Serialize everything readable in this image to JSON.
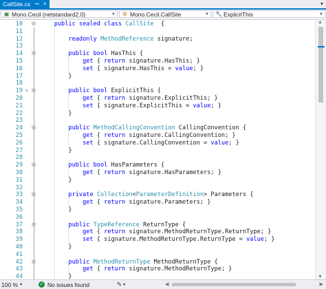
{
  "tab": {
    "title": "CallSite.cs",
    "pin_icon": "pin-icon",
    "close": "×",
    "overflow": "▾"
  },
  "nav": {
    "project": "Mono.Cecil (netstandard2.0)",
    "class": "Mono.Cecil.CallSite",
    "member": "ExplicitThis"
  },
  "editor": {
    "lines": [
      {
        "n": "10",
        "fold": "⊟",
        "code": [
          [
            "    ",
            ""
          ],
          [
            "public sealed class ",
            "kw"
          ],
          [
            "CallSite",
            "ty"
          ],
          [
            "  {",
            ""
          ]
        ]
      },
      {
        "n": "11",
        "fold": "",
        "code": []
      },
      {
        "n": "12",
        "fold": "",
        "code": [
          [
            "        ",
            ""
          ],
          [
            "readonly ",
            "kw"
          ],
          [
            "MethodReference",
            "ty"
          ],
          [
            " signature;",
            ""
          ]
        ]
      },
      {
        "n": "13",
        "fold": "",
        "code": []
      },
      {
        "n": "14",
        "fold": "⊟",
        "code": [
          [
            "        ",
            ""
          ],
          [
            "public bool ",
            "kw"
          ],
          [
            "HasThis {",
            ""
          ]
        ]
      },
      {
        "n": "15",
        "fold": "",
        "code": [
          [
            "            ",
            ""
          ],
          [
            "get",
            "kw"
          ],
          [
            " { ",
            ""
          ],
          [
            "return",
            "kw"
          ],
          [
            " signature.HasThis; }",
            ""
          ]
        ]
      },
      {
        "n": "16",
        "fold": "",
        "code": [
          [
            "            ",
            ""
          ],
          [
            "set",
            "kw"
          ],
          [
            " { signature.HasThis = ",
            ""
          ],
          [
            "value",
            "kw"
          ],
          [
            "; }",
            ""
          ]
        ]
      },
      {
        "n": "17",
        "fold": "",
        "code": [
          [
            "        }",
            ""
          ]
        ]
      },
      {
        "n": "18",
        "fold": "",
        "code": []
      },
      {
        "n": "19",
        "fold": "⊟",
        "glyph": "✎",
        "code": [
          [
            "        ",
            ""
          ],
          [
            "public bool ",
            "kw"
          ],
          [
            "ExplicitThis {",
            ""
          ]
        ]
      },
      {
        "n": "20",
        "fold": "",
        "code": [
          [
            "            ",
            ""
          ],
          [
            "get",
            "kw"
          ],
          [
            " { ",
            ""
          ],
          [
            "return",
            "kw"
          ],
          [
            " signature.ExplicitThis; }",
            ""
          ]
        ]
      },
      {
        "n": "21",
        "fold": "",
        "code": [
          [
            "            ",
            ""
          ],
          [
            "set",
            "kw"
          ],
          [
            " { signature.ExplicitThis = ",
            ""
          ],
          [
            "value",
            "kw"
          ],
          [
            "; }",
            ""
          ]
        ]
      },
      {
        "n": "22",
        "fold": "",
        "code": [
          [
            "        }",
            ""
          ]
        ]
      },
      {
        "n": "23",
        "fold": "",
        "code": []
      },
      {
        "n": "24",
        "fold": "⊟",
        "code": [
          [
            "        ",
            ""
          ],
          [
            "public ",
            "kw"
          ],
          [
            "MethodCallingConvention",
            "ty"
          ],
          [
            " CallingConvention {",
            ""
          ]
        ]
      },
      {
        "n": "25",
        "fold": "",
        "code": [
          [
            "            ",
            ""
          ],
          [
            "get",
            "kw"
          ],
          [
            " { ",
            ""
          ],
          [
            "return",
            "kw"
          ],
          [
            " signature.CallingConvention; }",
            ""
          ]
        ]
      },
      {
        "n": "26",
        "fold": "",
        "code": [
          [
            "            ",
            ""
          ],
          [
            "set",
            "kw"
          ],
          [
            " { signature.CallingConvention = ",
            ""
          ],
          [
            "value",
            "kw"
          ],
          [
            "; }",
            ""
          ]
        ]
      },
      {
        "n": "27",
        "fold": "",
        "code": [
          [
            "        }",
            ""
          ]
        ]
      },
      {
        "n": "28",
        "fold": "",
        "code": []
      },
      {
        "n": "29",
        "fold": "⊟",
        "code": [
          [
            "        ",
            ""
          ],
          [
            "public bool ",
            "kw"
          ],
          [
            "HasParameters {",
            ""
          ]
        ]
      },
      {
        "n": "30",
        "fold": "",
        "code": [
          [
            "            ",
            ""
          ],
          [
            "get",
            "kw"
          ],
          [
            " { ",
            ""
          ],
          [
            "return",
            "kw"
          ],
          [
            " signature.HasParameters; }",
            ""
          ]
        ]
      },
      {
        "n": "31",
        "fold": "",
        "code": [
          [
            "        }",
            ""
          ]
        ]
      },
      {
        "n": "32",
        "fold": "",
        "code": []
      },
      {
        "n": "33",
        "fold": "⊟",
        "code": [
          [
            "        ",
            ""
          ],
          [
            "private ",
            "kw"
          ],
          [
            "Collection",
            "ty"
          ],
          [
            "<",
            ""
          ],
          [
            "ParameterDefinition",
            "ty"
          ],
          [
            "> Parameters {",
            ""
          ]
        ]
      },
      {
        "n": "34",
        "fold": "",
        "code": [
          [
            "            ",
            ""
          ],
          [
            "get",
            "kw"
          ],
          [
            " { ",
            ""
          ],
          [
            "return",
            "kw"
          ],
          [
            " signature.Parameters; }",
            ""
          ]
        ]
      },
      {
        "n": "35",
        "fold": "",
        "code": [
          [
            "        }",
            ""
          ]
        ]
      },
      {
        "n": "36",
        "fold": "",
        "code": []
      },
      {
        "n": "37",
        "fold": "⊟",
        "code": [
          [
            "        ",
            ""
          ],
          [
            "public ",
            "kw"
          ],
          [
            "TypeReference",
            "ty"
          ],
          [
            " ReturnType {",
            ""
          ]
        ]
      },
      {
        "n": "38",
        "fold": "",
        "code": [
          [
            "            ",
            ""
          ],
          [
            "get",
            "kw"
          ],
          [
            " { ",
            ""
          ],
          [
            "return",
            "kw"
          ],
          [
            " signature.MethodReturnType.ReturnType; }",
            ""
          ]
        ]
      },
      {
        "n": "39",
        "fold": "",
        "code": [
          [
            "            ",
            ""
          ],
          [
            "set",
            "kw"
          ],
          [
            " { signature.MethodReturnType.ReturnType = ",
            ""
          ],
          [
            "value",
            "kw"
          ],
          [
            "; }",
            ""
          ]
        ]
      },
      {
        "n": "40",
        "fold": "",
        "code": [
          [
            "        }",
            ""
          ]
        ]
      },
      {
        "n": "41",
        "fold": "",
        "code": []
      },
      {
        "n": "42",
        "fold": "⊟",
        "code": [
          [
            "        ",
            ""
          ],
          [
            "public ",
            "kw"
          ],
          [
            "MethodReturnType",
            "ty"
          ],
          [
            " MethodReturnType {",
            ""
          ]
        ]
      },
      {
        "n": "43",
        "fold": "",
        "code": [
          [
            "            ",
            ""
          ],
          [
            "get",
            "kw"
          ],
          [
            " { ",
            ""
          ],
          [
            "return",
            "kw"
          ],
          [
            " signature.MethodReturnType; }",
            ""
          ]
        ]
      },
      {
        "n": "44",
        "fold": "",
        "code": [
          [
            "        }",
            ""
          ]
        ]
      }
    ]
  },
  "status": {
    "zoom": "100 %",
    "zoom_arrow": "▾",
    "issues": "No issues found",
    "ok_icon": "✓",
    "brush_icon": "brush-icon",
    "brush_arrow": "▾"
  },
  "colors": {
    "accent": "#007acc",
    "keyword": "#0000ff",
    "type": "#2b91af"
  }
}
